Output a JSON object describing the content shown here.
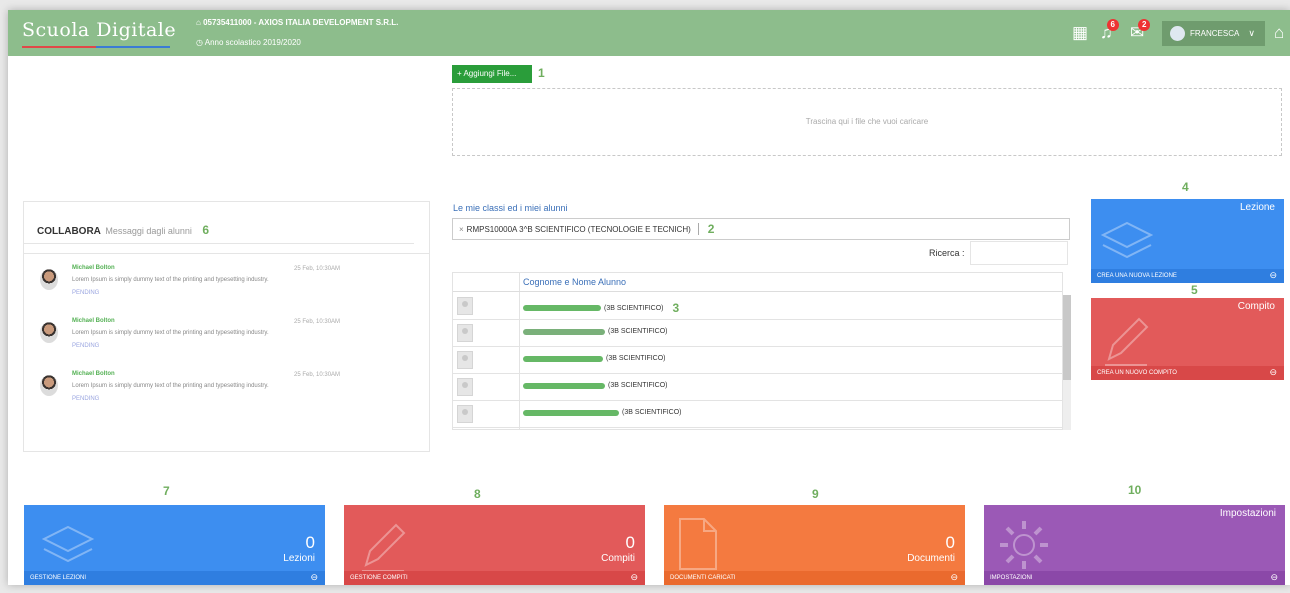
{
  "header": {
    "app_name": "Scuola Digitale",
    "school": "05735411000 - AXIOS ITALIA DEVELOPMENT S.R.L.",
    "school_year": "Anno scolastico 2019/2020",
    "bell_badge": "6",
    "mail_badge": "2",
    "user_name": "FRANCESCA"
  },
  "upload": {
    "add_label": "+ Aggiungi File...",
    "dropzone_text": "Trascina qui i file che vuoi caricare",
    "step": "1"
  },
  "collabora": {
    "title": "COLLABORA",
    "subtitle": "Messaggi dagli alunni",
    "step": "6",
    "messages": [
      {
        "name": "Michael Bolton",
        "time": "25 Feb, 10:30AM",
        "text": "Lorem Ipsum is simply dummy text of the printing and typesetting industry.",
        "status": "PENDING"
      },
      {
        "name": "Michael Bolton",
        "time": "25 Feb, 10:30AM",
        "text": "Lorem Ipsum is simply dummy text of the printing and typesetting industry.",
        "status": "PENDING"
      },
      {
        "name": "Michael Bolton",
        "time": "25 Feb, 10:30AM",
        "text": "Lorem Ipsum is simply dummy text of the printing and typesetting industry.",
        "status": "PENDING"
      }
    ]
  },
  "classes": {
    "title": "Le mie classi ed i miei alunni",
    "selected_class": "RMPS10000A 3^B SCIENTIFICO (TECNOLOGIE E TECNICH)",
    "remove_glyph": "×",
    "step": "2",
    "search_label": "Ricerca :",
    "column_header": "Cognome e Nome Alunno",
    "students_step": "3",
    "students": [
      {
        "suffix": "(3B SCIENTIFICO)"
      },
      {
        "suffix": "(3B SCIENTIFICO)"
      },
      {
        "suffix": "(3B SCIENTIFICO)"
      },
      {
        "suffix": "(3B SCIENTIFICO)"
      },
      {
        "suffix": "(3B SCIENTIFICO)"
      }
    ]
  },
  "actions": {
    "lezione": {
      "step": "4",
      "title": "Lezione",
      "footer": "CREA UNA NUOVA LEZIONE",
      "color": "#3d8ef0"
    },
    "compito": {
      "step": "5",
      "title": "Compito",
      "footer": "CREA UN NUOVO COMPITO",
      "color": "#e25a5a"
    }
  },
  "stats": [
    {
      "step": "7",
      "value": "0",
      "label": "Lezioni",
      "footer": "GESTIONE LEZIONI",
      "color": "#3d8ef0"
    },
    {
      "step": "8",
      "value": "0",
      "label": "Compiti",
      "footer": "GESTIONE COMPITI",
      "color": "#e25a5a"
    },
    {
      "step": "9",
      "value": "0",
      "label": "Documenti",
      "footer": "DOCUMENTI CARICATI",
      "color": "#f47a40"
    },
    {
      "step": "10",
      "value": "",
      "label": "Impostazioni",
      "footer": "IMPOSTAZIONI",
      "color": "#9b59b6"
    }
  ]
}
